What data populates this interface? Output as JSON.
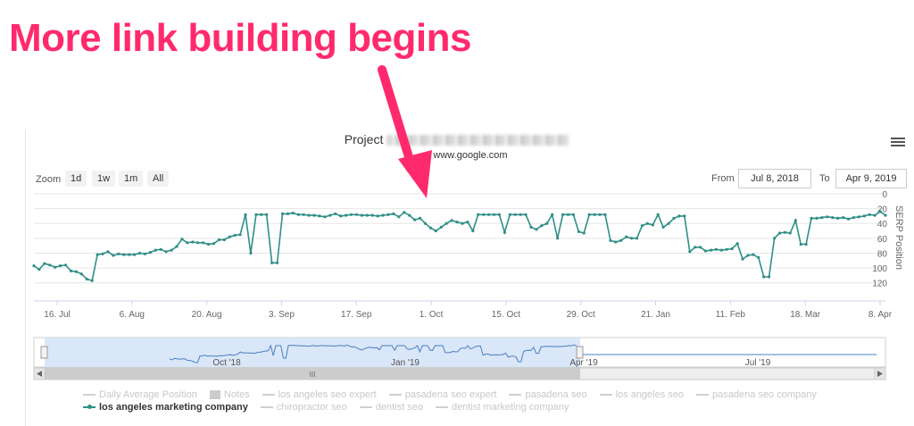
{
  "headline": "More link building begins",
  "chart": {
    "title_prefix": "Project",
    "subtitle": "www.google.com",
    "menu_icon": "hamburger-icon",
    "zoom": {
      "label": "Zoom",
      "buttons": [
        "1d",
        "1w",
        "1m",
        "All"
      ]
    },
    "range": {
      "from_label": "From",
      "from_value": "Jul 8, 2018",
      "to_label": "To",
      "to_value": "Apr 9, 2019"
    },
    "y_axis_title": "SERP Position",
    "navigator_labels": [
      "Oct '18",
      "Jan '19",
      "Apr '19",
      "Jul '19"
    ],
    "navigator_grip": "III",
    "colors": {
      "series": "#2f8f86",
      "headline": "#ff2a6d",
      "arrow": "#ff2a6d",
      "navigator": "#4a7fc1"
    }
  },
  "chart_data": {
    "type": "line",
    "title": "Project",
    "subtitle": "www.google.com",
    "xlabel": "",
    "ylabel": "SERP Position",
    "x_ticks": [
      "16. Jul",
      "6. Aug",
      "20. Aug",
      "3. Sep",
      "17. Sep",
      "1. Oct",
      "15. Oct",
      "29. Oct",
      "21. Jan",
      "11. Feb",
      "18. Mar",
      "8. Apr"
    ],
    "y_ticks": [
      0,
      20,
      40,
      60,
      80,
      100,
      120
    ],
    "ylim": [
      0,
      130
    ],
    "y_reversed": true,
    "grid": true,
    "legend_position": "bottom",
    "series": [
      {
        "name": "los angeles marketing company",
        "values": [
          97,
          102,
          94,
          96,
          99,
          97,
          96,
          104,
          105,
          108,
          115,
          117,
          82,
          81,
          78,
          83,
          81,
          82,
          82,
          82,
          80,
          81,
          79,
          76,
          75,
          78,
          76,
          71,
          61,
          66,
          65,
          66,
          66,
          68,
          67,
          62,
          62,
          58,
          56,
          55,
          28,
          80,
          28,
          28,
          28,
          93,
          93,
          27,
          27,
          26,
          28,
          28,
          29,
          29,
          30,
          31,
          29,
          27,
          30,
          29,
          28,
          28,
          29,
          29,
          29,
          30,
          29,
          28,
          27,
          31,
          25,
          29,
          35,
          33,
          40,
          46,
          50,
          45,
          40,
          36,
          38,
          40,
          38,
          50,
          28,
          28,
          28,
          28,
          28,
          52,
          28,
          28,
          28,
          28,
          45,
          48,
          43,
          40,
          28,
          60,
          28,
          28,
          28,
          51,
          53,
          28,
          28,
          28,
          28,
          63,
          65,
          63,
          58,
          60,
          60,
          43,
          40,
          42,
          28,
          45,
          40,
          33,
          30,
          30,
          78,
          72,
          72,
          77,
          76,
          75,
          76,
          75,
          74,
          67,
          88,
          83,
          82,
          86,
          112,
          112,
          60,
          53,
          52,
          53,
          36,
          68,
          68,
          33,
          33,
          32,
          31,
          32,
          33,
          32,
          34,
          32,
          31,
          30,
          28,
          29,
          24,
          29
        ]
      }
    ],
    "legend": [
      {
        "name": "Daily Average Position",
        "active": false,
        "symbol": "line"
      },
      {
        "name": "Notes",
        "active": false,
        "symbol": "box"
      },
      {
        "name": "los angeles seo expert",
        "active": false,
        "symbol": "line"
      },
      {
        "name": "pasadena seo expert",
        "active": false,
        "symbol": "line"
      },
      {
        "name": "pasadena seo",
        "active": false,
        "symbol": "line"
      },
      {
        "name": "los angeles seo",
        "active": false,
        "symbol": "line"
      },
      {
        "name": "pasadena seo company",
        "active": false,
        "symbol": "line"
      },
      {
        "name": "los angeles marketing company",
        "active": true,
        "symbol": "line"
      },
      {
        "name": "chiropractor seo",
        "active": false,
        "symbol": "line"
      },
      {
        "name": "dentist seo",
        "active": false,
        "symbol": "line"
      },
      {
        "name": "dentist marketing company",
        "active": false,
        "symbol": "line"
      }
    ]
  }
}
